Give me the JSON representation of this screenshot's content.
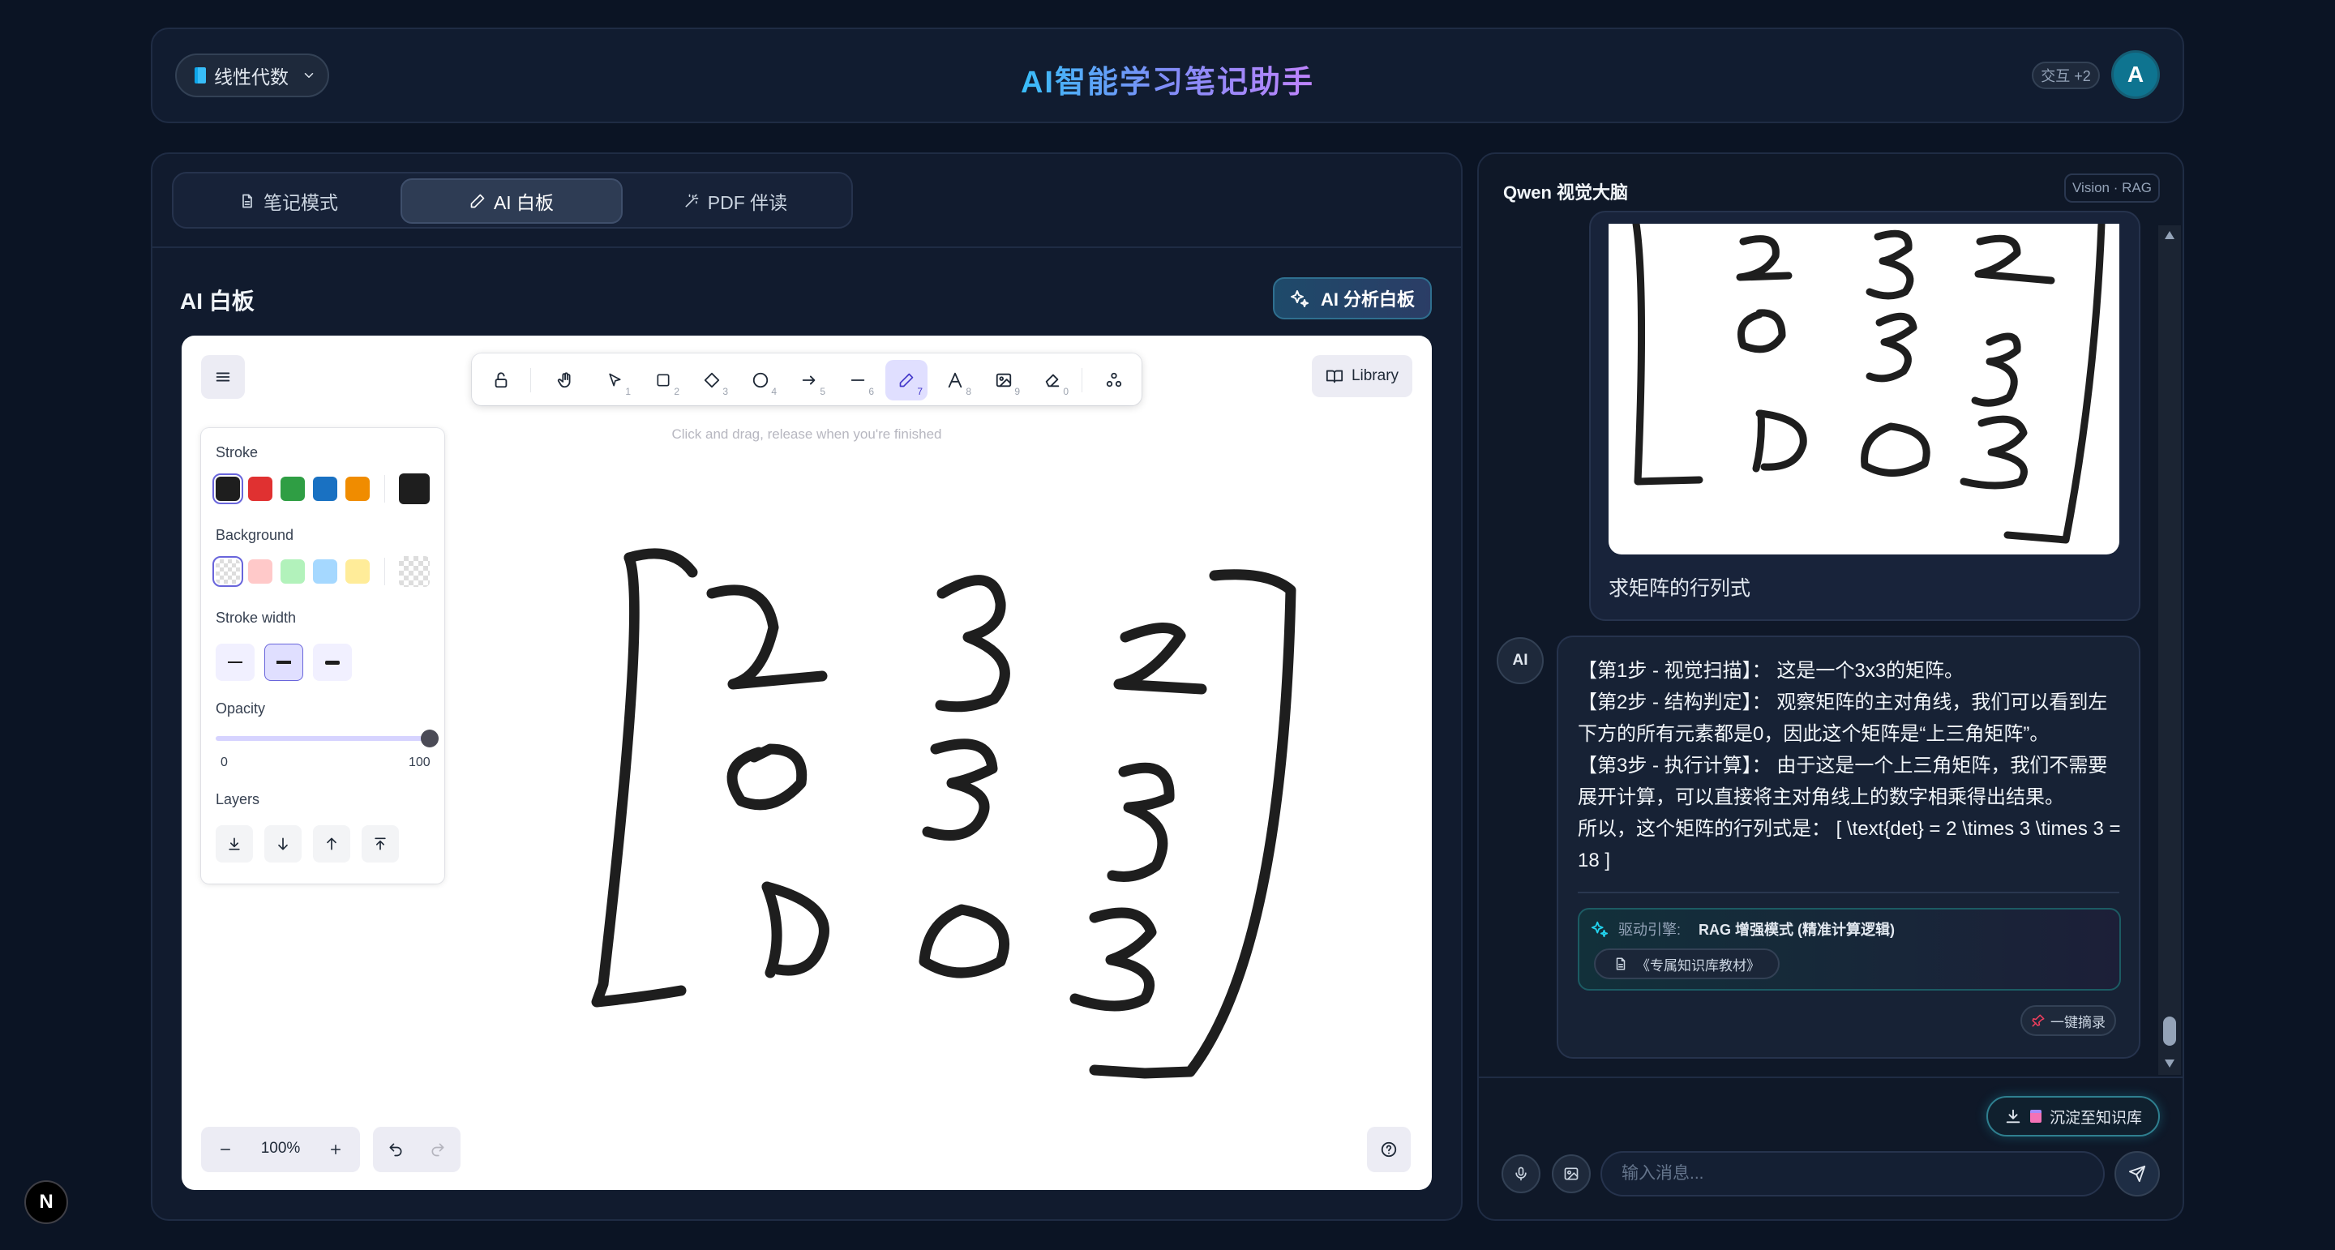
{
  "header": {
    "subject": "线性代数",
    "title": "AI智能学习笔记助手",
    "interaction_badge": "交互 +2",
    "avatar_letter": "A"
  },
  "tabs": [
    {
      "label": "笔记模式",
      "icon": "document-icon"
    },
    {
      "label": "AI 白板",
      "icon": "pen-icon",
      "active": true
    },
    {
      "label": "PDF 伴读",
      "icon": "magic-wand-icon"
    }
  ],
  "whiteboard": {
    "section_title": "AI 白板",
    "analyze_button": "AI 分析白板",
    "library_button": "Library",
    "hint": "Click and drag, release when you're finished",
    "toolbar_shortcuts": [
      "1",
      "2",
      "3",
      "4",
      "5",
      "6",
      "7",
      "8",
      "9",
      "0"
    ],
    "active_tool": "pen",
    "props": {
      "stroke_label": "Stroke",
      "background_label": "Background",
      "stroke_width_label": "Stroke width",
      "opacity_label": "Opacity",
      "opacity_min": "0",
      "opacity_max": "100",
      "opacity_value": 100,
      "layers_label": "Layers",
      "stroke_colors": [
        "#1e1e1e",
        "#e03131",
        "#2f9e44",
        "#1971c2",
        "#f08c00"
      ],
      "current_stroke": "#1e1e1e",
      "background_colors": [
        "transparent",
        "#ffc9c9",
        "#b2f2bb",
        "#a5d8ff",
        "#ffec99"
      ]
    },
    "zoom": "100%",
    "matrix": [
      [
        "2",
        "3",
        "2"
      ],
      [
        "0",
        "3",
        "3"
      ],
      [
        "0",
        "0",
        "3"
      ]
    ]
  },
  "chat": {
    "title": "Qwen 视觉大脑",
    "badge": "Vision · RAG",
    "user_message": "求矩阵的行列式",
    "ai_label": "AI",
    "ai_lines": [
      "【第1步 - 视觉扫描】： 这是一个3x3的矩阵。",
      "【第2步 - 结构判定】： 观察矩阵的主对角线，我们可以看到左下方的所有元素都是0，因此这个矩阵是“上三角矩阵”。",
      "【第3步 - 执行计算】： 由于这是一个上三角矩阵，我们不需要展开计算，可以直接将主对角线上的数字相乘得出结果。",
      "所以，这个矩阵的行列式是： [ \\text{det} = 2 \\times 3 \\times 3 = 18 ]"
    ],
    "engine_label": "驱动引擎:",
    "engine_mode": "RAG 增强模式 (精准计算逻辑)",
    "source": "《专属知识库教材》",
    "excerpt_button": "一键摘录",
    "save_button": "沉淀至知识库",
    "input_placeholder": "输入消息..."
  },
  "dev_badge": "N",
  "colors": {
    "background": "#0b1424",
    "accent_cyan": "#22d3ee",
    "excalidraw_purple": "#6965db"
  }
}
